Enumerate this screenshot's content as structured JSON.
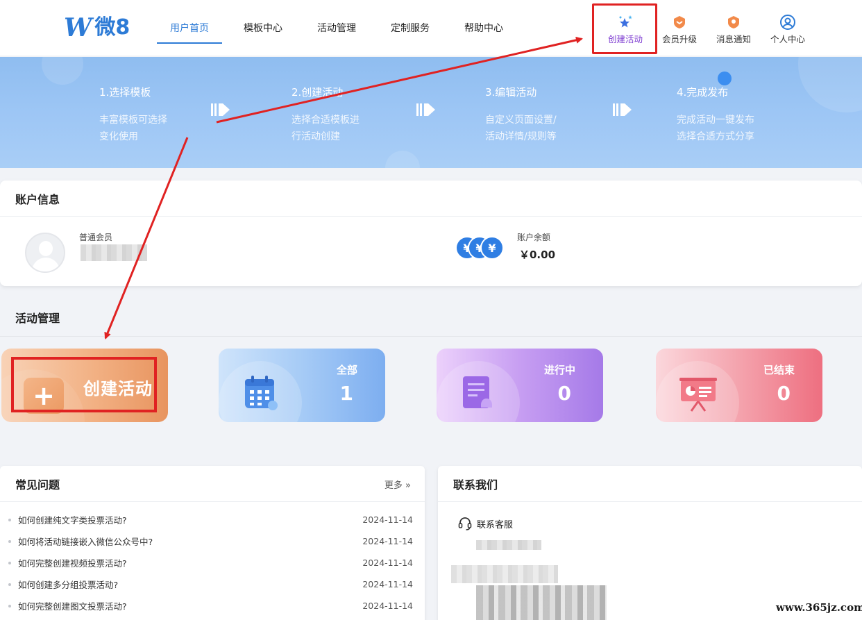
{
  "header": {
    "logo_mark": "W",
    "logo_text": "微8",
    "nav": [
      {
        "label": "用户首页",
        "active": true
      },
      {
        "label": "模板中心",
        "active": false
      },
      {
        "label": "活动管理",
        "active": false
      },
      {
        "label": "定制服务",
        "active": false
      },
      {
        "label": "帮助中心",
        "active": false
      }
    ],
    "tools": [
      {
        "label": "创建活动",
        "icon": "stars-icon"
      },
      {
        "label": "会员升级",
        "icon": "badge-icon"
      },
      {
        "label": "消息通知",
        "icon": "bell-badge-icon"
      },
      {
        "label": "个人中心",
        "icon": "user-circle-icon"
      }
    ]
  },
  "banner": {
    "steps": [
      {
        "title": "1.选择模板",
        "line1": "丰富模板可选择",
        "line2": "变化使用"
      },
      {
        "title": "2.创建活动",
        "line1": "选择合适模板进",
        "line2": "行活动创建"
      },
      {
        "title": "3.编辑活动",
        "line1": "自定义页面设置/",
        "line2": "活动详情/规则等"
      },
      {
        "title": "4.完成发布",
        "line1": "完成活动一键发布",
        "line2": "选择合适方式分享"
      }
    ]
  },
  "account": {
    "title": "账户信息",
    "member_type": "普通会员",
    "balance_label": "账户余额",
    "balance_value": "￥0.00",
    "coin_symbol": "¥"
  },
  "activity": {
    "title": "活动管理",
    "create_label": "创建活动",
    "create_symbol": "+",
    "cards": [
      {
        "label": "全部",
        "count": "1"
      },
      {
        "label": "进行中",
        "count": "0"
      },
      {
        "label": "已结束",
        "count": "0"
      }
    ]
  },
  "faq": {
    "title": "常见问题",
    "more": "更多 »",
    "items": [
      {
        "q": "如何创建纯文字类投票活动?",
        "date": "2024-11-14"
      },
      {
        "q": "如何将活动链接嵌入微信公众号中?",
        "date": "2024-11-14"
      },
      {
        "q": "如何完整创建视频投票活动?",
        "date": "2024-11-14"
      },
      {
        "q": "如何创建多分组投票活动?",
        "date": "2024-11-14"
      },
      {
        "q": "如何完整创建图文投票活动?",
        "date": "2024-11-14"
      }
    ]
  },
  "contact": {
    "title": "联系我们",
    "service_label": "联系客服"
  },
  "watermark": "www.365jz.com",
  "colors": {
    "brand": "#2d7bd6",
    "annotation_red": "#e02222",
    "create_purple": "#7d3bd1"
  }
}
